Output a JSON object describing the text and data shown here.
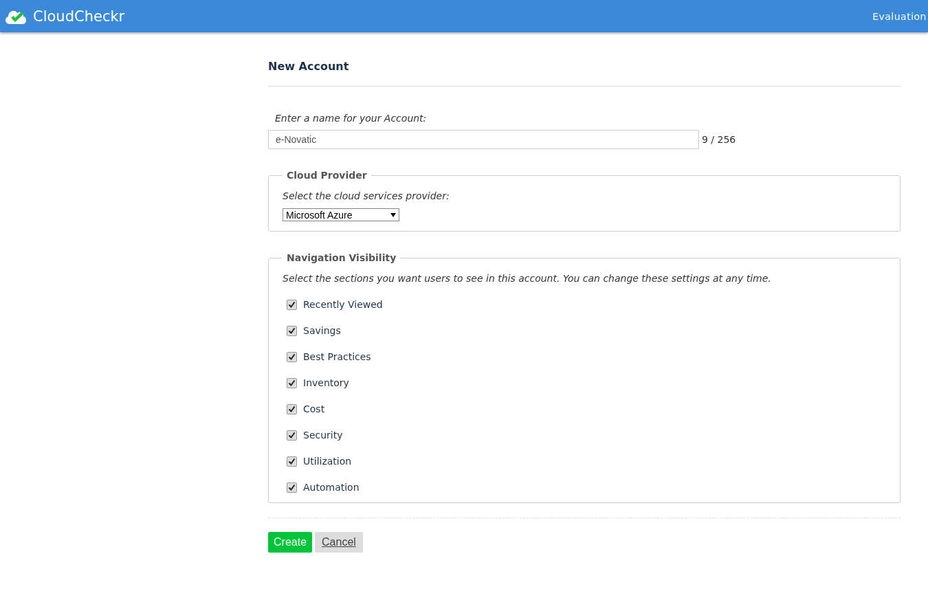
{
  "header": {
    "brand": "CloudCheckr",
    "right_label": "Evaluation"
  },
  "title": "New Account",
  "name_field": {
    "label": "Enter a name for your Account:",
    "value": "e-Novatic",
    "counter": "9 / 256"
  },
  "cloud_provider": {
    "legend": "Cloud Provider",
    "prompt": "Select the cloud services provider:",
    "selected_option": "Microsoft Azure"
  },
  "navigation_visibility": {
    "legend": "Navigation Visibility",
    "prompt": "Select the sections you want users to see in this account. You can change these settings at any time.",
    "items": [
      {
        "label": "Recently Viewed",
        "checked": true
      },
      {
        "label": "Savings",
        "checked": true
      },
      {
        "label": "Best Practices",
        "checked": true
      },
      {
        "label": "Inventory",
        "checked": true
      },
      {
        "label": "Cost",
        "checked": true
      },
      {
        "label": "Security",
        "checked": true
      },
      {
        "label": "Utilization",
        "checked": true
      },
      {
        "label": "Automation",
        "checked": true
      }
    ]
  },
  "buttons": {
    "create": "Create",
    "cancel": "Cancel"
  }
}
